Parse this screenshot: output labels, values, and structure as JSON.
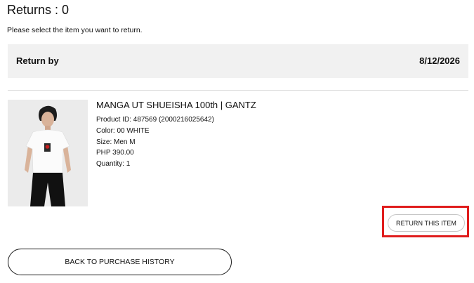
{
  "header": {
    "returns_title": "Returns : 0",
    "instructions": "Please select the item you want to return."
  },
  "return_by": {
    "label": "Return by",
    "date": "8/12/2026"
  },
  "product": {
    "name": "MANGA UT SHUEISHA 100th | GANTZ",
    "product_id": "Product ID: 487569 (2000216025642)",
    "color": "Color: 00 WHITE",
    "size": "Size: Men M",
    "price": "PHP 390.00",
    "quantity": "Quantity: 1"
  },
  "actions": {
    "return_item_label": "RETURN THIS ITEM",
    "back_label": "BACK TO PURCHASE HISTORY"
  },
  "colors": {
    "highlight": "#e01d1d",
    "panel_bg": "#f1f1f1"
  }
}
